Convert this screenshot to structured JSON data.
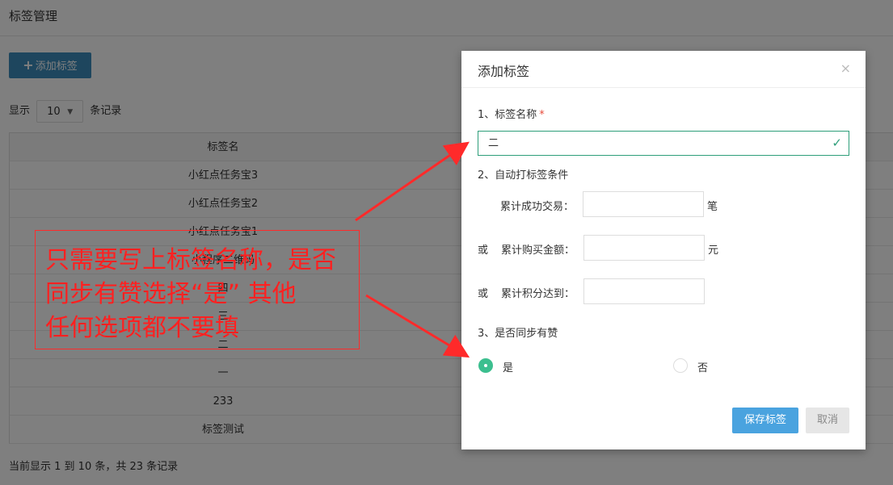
{
  "page": {
    "title": "标签管理",
    "add_button": "添加标签",
    "show_prefix": "显示",
    "page_size": "10",
    "show_suffix": "条记录",
    "table_header": "标签名",
    "rows": [
      "小红点任务宝3",
      "小红点任务宝2",
      "小红点任务宝1",
      "小程序二维码",
      "四",
      "三",
      "二",
      "一",
      "233",
      "标签测试"
    ],
    "footer_info": "当前显示 1 到 10 条，共 23 条记录"
  },
  "modal": {
    "title": "添加标签",
    "close_glyph": "×",
    "section1_label": "1、标签名称",
    "required_mark": "*",
    "name_value": "二",
    "section2_label": "2、自动打标签条件",
    "cond1_label": "累计成功交易：",
    "cond1_unit": "笔",
    "or_label": "或",
    "cond2_label": "累计购买金额：",
    "cond2_unit": "元",
    "cond3_label": "累计积分达到：",
    "section3_label": "3、是否同步有赞",
    "radio_yes": "是",
    "radio_no": "否",
    "save_button": "保存标签",
    "cancel_button": "取消"
  },
  "annotation": {
    "text": "只需要写上标签名称，是否\n同步有赞选择“是”  其他\n任何选项都不要填",
    "color": "#ff2020"
  },
  "colors": {
    "primary_button": "#3c8dbc",
    "save_button": "#4aa3df",
    "success_green": "#3cbf8f",
    "annotation_red": "#ff2020"
  }
}
